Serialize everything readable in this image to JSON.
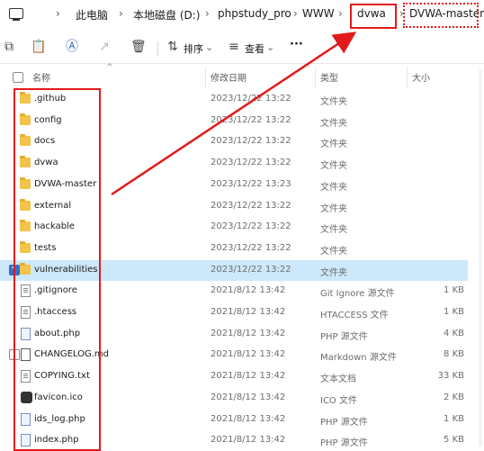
{
  "breadcrumb": {
    "items": [
      "此电脑",
      "本地磁盘 (D:)",
      "phpstudy_pro",
      "WWW",
      "dvwa",
      "DVWA-master"
    ]
  },
  "toolbar": {
    "sort_label": "排序",
    "view_label": "查看",
    "more_label": "···"
  },
  "columns": {
    "name": "名称",
    "date": "修改日期",
    "type": "类型",
    "size": "大小"
  },
  "files": [
    {
      "name": ".github",
      "date": "2023/12/22 13:22",
      "type": "文件夹",
      "size": "",
      "icon": "folder-icon"
    },
    {
      "name": "config",
      "date": "2023/12/22 13:22",
      "type": "文件夹",
      "size": "",
      "icon": "folder-icon"
    },
    {
      "name": "docs",
      "date": "2023/12/22 13:22",
      "type": "文件夹",
      "size": "",
      "icon": "folder-icon"
    },
    {
      "name": "dvwa",
      "date": "2023/12/22 13:22",
      "type": "文件夹",
      "size": "",
      "icon": "folder-icon"
    },
    {
      "name": "DVWA-master",
      "date": "2023/12/22 13:23",
      "type": "文件夹",
      "size": "",
      "icon": "folder-icon"
    },
    {
      "name": "external",
      "date": "2023/12/22 13:22",
      "type": "文件夹",
      "size": "",
      "icon": "folder-icon"
    },
    {
      "name": "hackable",
      "date": "2023/12/22 13:22",
      "type": "文件夹",
      "size": "",
      "icon": "folder-icon"
    },
    {
      "name": "tests",
      "date": "2023/12/22 13:22",
      "type": "文件夹",
      "size": "",
      "icon": "folder-icon"
    },
    {
      "name": "vulnerabilities",
      "date": "2023/12/22 13:22",
      "type": "文件夹",
      "size": "",
      "icon": "folder-icon"
    },
    {
      "name": ".gitignore",
      "date": "2021/8/12 13:42",
      "type": "Git Ignore 源文件",
      "size": "1 KB",
      "icon": "file-icon"
    },
    {
      "name": ".htaccess",
      "date": "2021/8/12 13:42",
      "type": "HTACCESS 文件",
      "size": "1 KB",
      "icon": "file-icon"
    },
    {
      "name": "about.php",
      "date": "2021/8/12 13:42",
      "type": "PHP 源文件",
      "size": "4 KB",
      "icon": "php-file-icon"
    },
    {
      "name": "CHANGELOG.md",
      "date": "2021/8/12 13:42",
      "type": "Markdown 源文件",
      "size": "8 KB",
      "icon": "markdown-file-icon"
    },
    {
      "name": "COPYING.txt",
      "date": "2021/8/12 13:42",
      "type": "文本文档",
      "size": "33 KB",
      "icon": "text-file-icon"
    },
    {
      "name": "favicon.ico",
      "date": "2021/8/12 13:42",
      "type": "ICO 文件",
      "size": "2 KB",
      "icon": "ico-file-icon"
    },
    {
      "name": "ids_log.php",
      "date": "2021/8/12 13:42",
      "type": "PHP 源文件",
      "size": "1 KB",
      "icon": "php-file-icon"
    },
    {
      "name": "index.php",
      "date": "2021/8/12 13:42",
      "type": "PHP 源文件",
      "size": "5 KB",
      "icon": "php-file-icon"
    }
  ],
  "selected_index": 8,
  "colors": {
    "annotation": "#e21a1a",
    "selection": "#cde8fb",
    "folder": "#f3c34c"
  }
}
